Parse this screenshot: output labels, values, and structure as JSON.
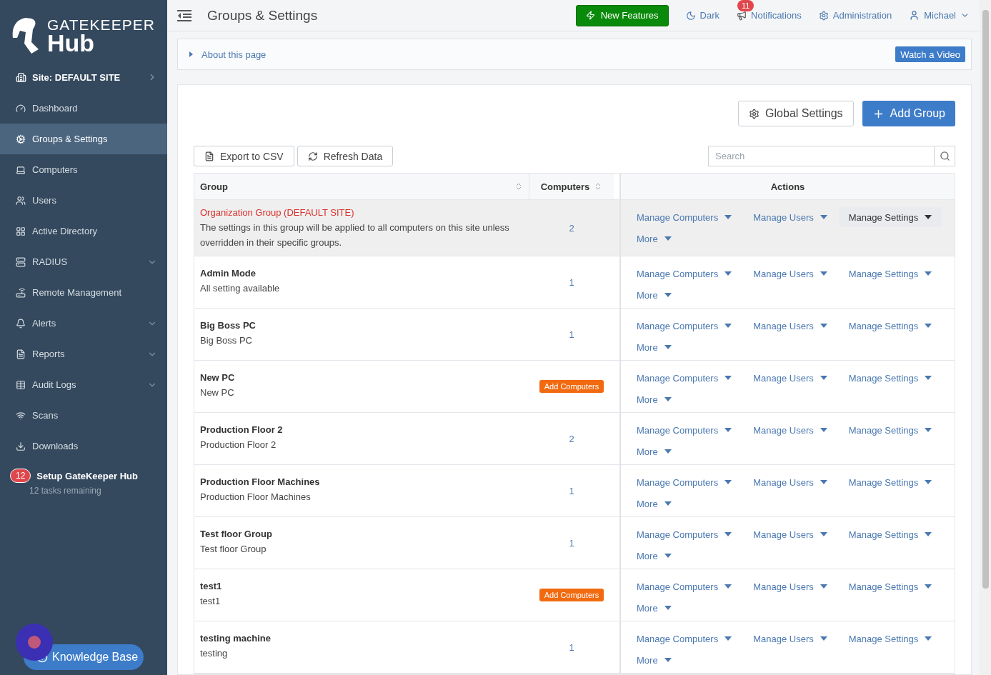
{
  "sidebar": {
    "logo": {
      "top": "GATEKEEPER",
      "bottom": "Hub"
    },
    "site": {
      "label": "Site: DEFAULT SITE"
    },
    "items": [
      {
        "label": "Dashboard",
        "selected": false,
        "expandable": false
      },
      {
        "label": "Groups & Settings",
        "selected": true,
        "expandable": false
      },
      {
        "label": "Computers",
        "selected": false,
        "expandable": false
      },
      {
        "label": "Users",
        "selected": false,
        "expandable": false
      },
      {
        "label": "Active Directory",
        "selected": false,
        "expandable": false
      },
      {
        "label": "RADIUS",
        "selected": false,
        "expandable": true
      },
      {
        "label": "Remote Management",
        "selected": false,
        "expandable": false
      },
      {
        "label": "Alerts",
        "selected": false,
        "expandable": true
      },
      {
        "label": "Reports",
        "selected": false,
        "expandable": true
      },
      {
        "label": "Audit Logs",
        "selected": false,
        "expandable": true
      },
      {
        "label": "Scans",
        "selected": false,
        "expandable": false
      },
      {
        "label": "Downloads",
        "selected": false,
        "expandable": false
      }
    ],
    "setup": {
      "badge": "12",
      "title": "Setup GateKeeper Hub",
      "subtitle": "12 tasks remaining"
    },
    "knowledge_base": "Knowledge Base"
  },
  "header": {
    "title": "Groups & Settings",
    "new_features": "New Features",
    "dark": "Dark",
    "notifications": {
      "label": "Notifications",
      "badge": "11"
    },
    "administration": "Administration",
    "user": "Michael"
  },
  "about": {
    "label": "About this page",
    "video": "Watch a Video"
  },
  "toolbar": {
    "global_settings": "Global Settings",
    "add_group": "Add Group",
    "export": "Export to CSV",
    "refresh": "Refresh Data",
    "search": {
      "placeholder": "Search"
    }
  },
  "table": {
    "columns": [
      "Group",
      "Computers",
      "Actions"
    ],
    "rows": [
      {
        "kind": "organization",
        "highlighted": true,
        "name": "Organization Group (DEFAULT SITE)",
        "description": "The settings in this group will be applied to all computers on this site unless overridden in their specific groups.",
        "computers": {
          "kind": "count",
          "text": "2"
        },
        "actions": [
          {
            "label": "Manage Computers",
            "active": false
          },
          {
            "label": "Manage Users",
            "active": false
          },
          {
            "label": "Manage Settings",
            "active": true
          },
          {
            "label": "More",
            "active": false
          }
        ]
      },
      {
        "kind": "group",
        "highlighted": false,
        "name": "Admin Mode",
        "description": "All setting available",
        "computers": {
          "kind": "count",
          "text": "1"
        },
        "actions": [
          {
            "label": "Manage Computers",
            "active": false
          },
          {
            "label": "Manage Users",
            "active": false
          },
          {
            "label": "Manage Settings",
            "active": false
          },
          {
            "label": "More",
            "active": false
          }
        ]
      },
      {
        "kind": "group",
        "highlighted": false,
        "name": "Big Boss PC",
        "description": "Big Boss PC",
        "computers": {
          "kind": "count",
          "text": "1"
        },
        "actions": [
          {
            "label": "Manage Computers",
            "active": false
          },
          {
            "label": "Manage Users",
            "active": false
          },
          {
            "label": "Manage Settings",
            "active": false
          },
          {
            "label": "More",
            "active": false
          }
        ]
      },
      {
        "kind": "group",
        "highlighted": false,
        "name": "New PC",
        "description": "New PC",
        "computers": {
          "kind": "button",
          "text": "Add Computers"
        },
        "actions": [
          {
            "label": "Manage Computers",
            "active": false
          },
          {
            "label": "Manage Users",
            "active": false
          },
          {
            "label": "Manage Settings",
            "active": false
          },
          {
            "label": "More",
            "active": false
          }
        ]
      },
      {
        "kind": "group",
        "highlighted": false,
        "name": "Production Floor 2",
        "description": "Production Floor 2",
        "computers": {
          "kind": "count",
          "text": "2"
        },
        "actions": [
          {
            "label": "Manage Computers",
            "active": false
          },
          {
            "label": "Manage Users",
            "active": false
          },
          {
            "label": "Manage Settings",
            "active": false
          },
          {
            "label": "More",
            "active": false
          }
        ]
      },
      {
        "kind": "group",
        "highlighted": false,
        "name": "Production Floor Machines",
        "description": "Production Floor Machines",
        "computers": {
          "kind": "count",
          "text": "1"
        },
        "actions": [
          {
            "label": "Manage Computers",
            "active": false
          },
          {
            "label": "Manage Users",
            "active": false
          },
          {
            "label": "Manage Settings",
            "active": false
          },
          {
            "label": "More",
            "active": false
          }
        ]
      },
      {
        "kind": "group",
        "highlighted": false,
        "name": "Test floor Group",
        "description": "Test floor Group",
        "computers": {
          "kind": "count",
          "text": "1"
        },
        "actions": [
          {
            "label": "Manage Computers",
            "active": false
          },
          {
            "label": "Manage Users",
            "active": false
          },
          {
            "label": "Manage Settings",
            "active": false
          },
          {
            "label": "More",
            "active": false
          }
        ]
      },
      {
        "kind": "group",
        "highlighted": false,
        "name": "test1",
        "description": "test1",
        "computers": {
          "kind": "button",
          "text": "Add Computers"
        },
        "actions": [
          {
            "label": "Manage Computers",
            "active": false
          },
          {
            "label": "Manage Users",
            "active": false
          },
          {
            "label": "Manage Settings",
            "active": false
          },
          {
            "label": "More",
            "active": false
          }
        ]
      },
      {
        "kind": "group",
        "highlighted": false,
        "name": "testing machine",
        "description": "testing",
        "computers": {
          "kind": "count",
          "text": "1"
        },
        "actions": [
          {
            "label": "Manage Computers",
            "active": false
          },
          {
            "label": "Manage Users",
            "active": false
          },
          {
            "label": "Manage Settings",
            "active": false
          },
          {
            "label": "More",
            "active": false
          }
        ]
      }
    ]
  }
}
